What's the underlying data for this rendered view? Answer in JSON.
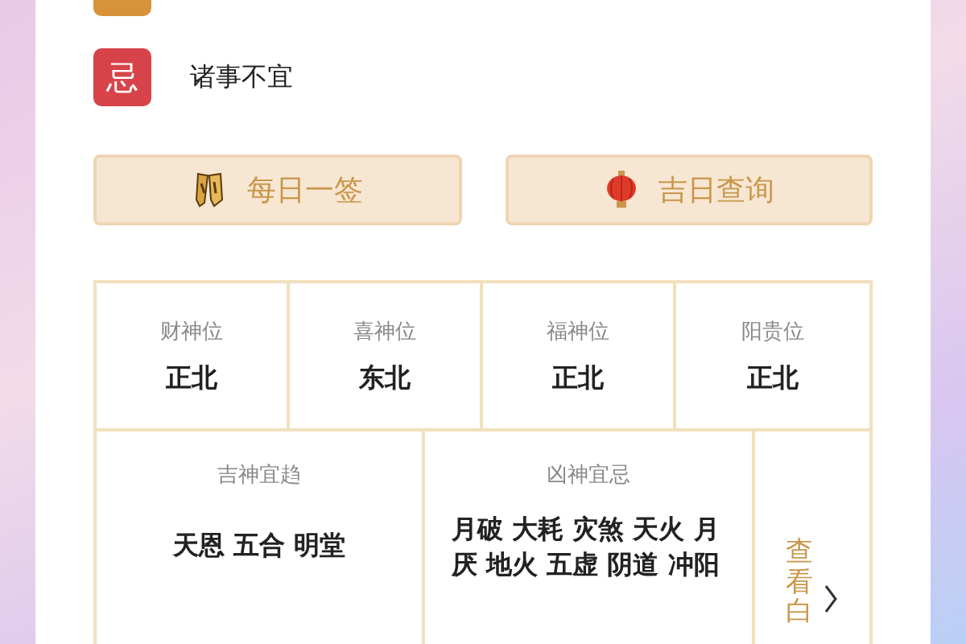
{
  "avoid": {
    "badge": "忌",
    "text": "诸事不宜"
  },
  "buttons": [
    {
      "kind": "sticks",
      "label": "每日一签"
    },
    {
      "kind": "lantern",
      "label": "吉日查询"
    }
  ],
  "directions": [
    {
      "label": "财神位",
      "value": "正北"
    },
    {
      "label": "喜神位",
      "value": "东北"
    },
    {
      "label": "福神位",
      "value": "正北"
    },
    {
      "label": "阳贵位",
      "value": "正北"
    }
  ],
  "gods": [
    {
      "label": "吉神宜趋",
      "value": "天恩 五合 明堂"
    },
    {
      "label": "凶神宜忌",
      "value": "月破 大耗 灾煞 天火 月厌 地火 五虚 阴道 冲阳"
    }
  ],
  "more_link": {
    "label": "查看白"
  }
}
